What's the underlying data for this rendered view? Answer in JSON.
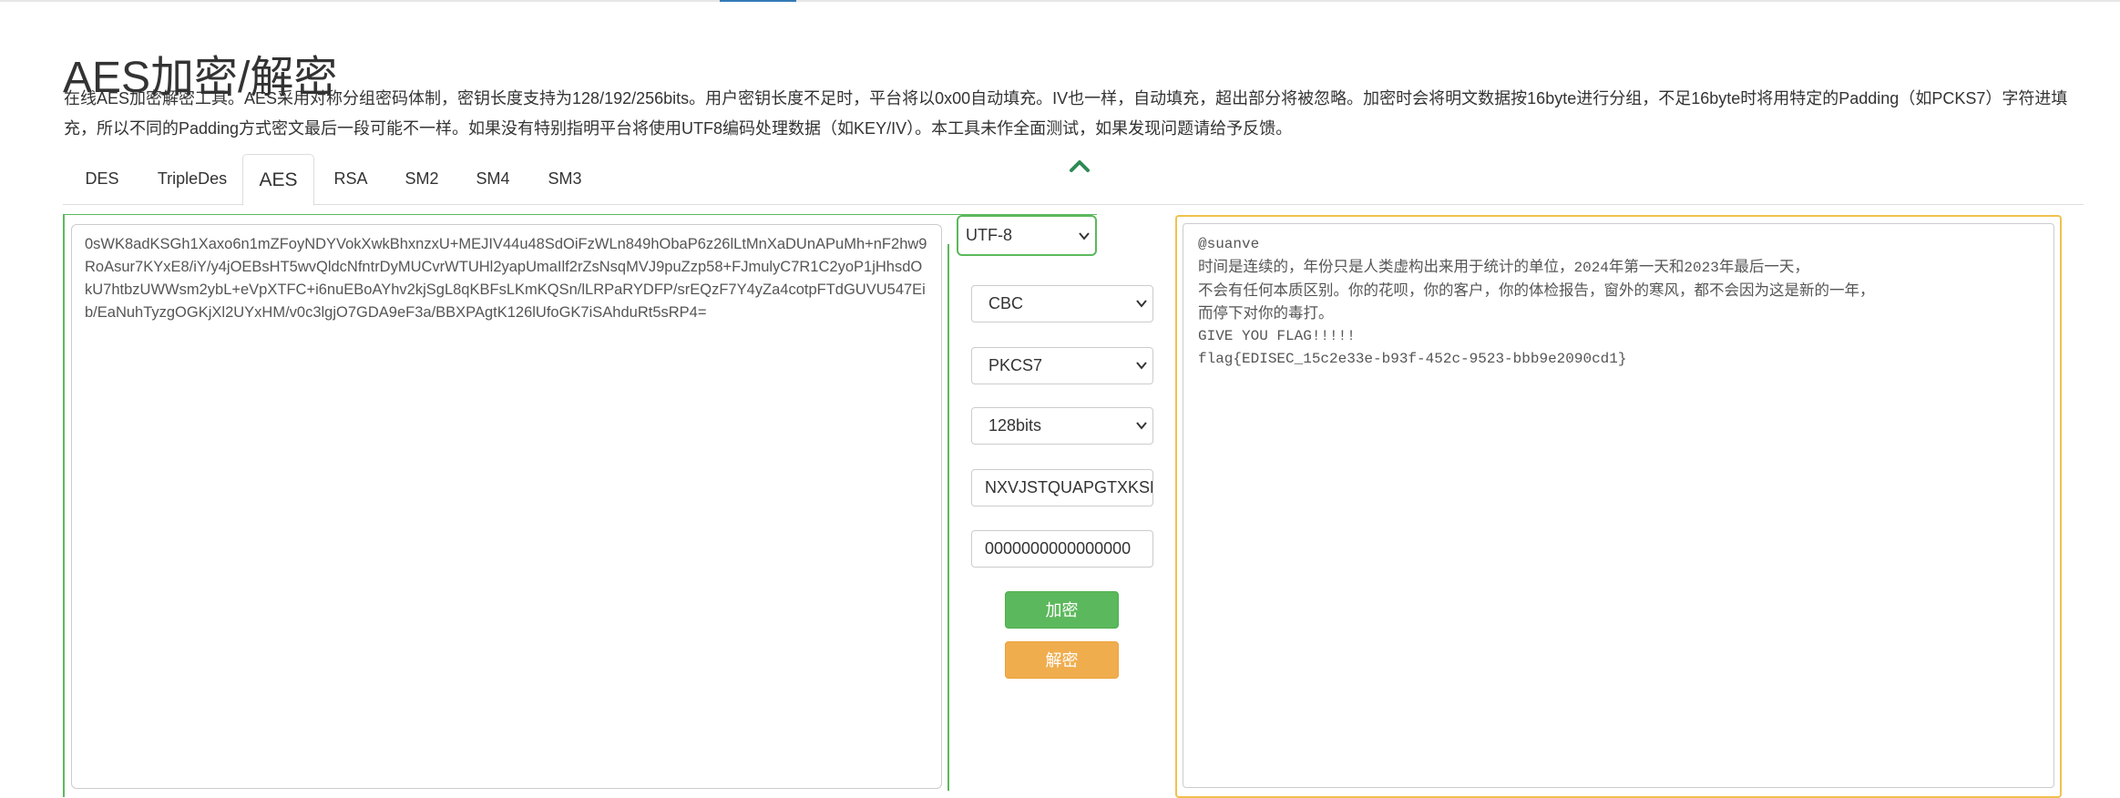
{
  "page": {
    "title": "AES加密/解密",
    "intro": "在线AES加密解密工具。AES采用对称分组密码体制，密钥长度支持为128/192/256bits。用户密钥长度不足时，平台将以0x00自动填充。IV也一样，自动填充，超出部分将被忽略。加密时会将明文数据按16byte进行分组，不足16byte时将用特定的Padding（如PCKS7）字符进填充，所以不同的Padding方式密文最后一段可能不一样。如果没有特别指明平台将使用UTF8编码处理数据（如KEY/IV）。本工具未作全面测试，如果发现问题请给予反馈。"
  },
  "tabs": [
    {
      "label": "DES"
    },
    {
      "label": "TripleDes"
    },
    {
      "label": "AES"
    },
    {
      "label": "RSA"
    },
    {
      "label": "SM2"
    },
    {
      "label": "SM4"
    },
    {
      "label": "SM3"
    }
  ],
  "active_tab": "AES",
  "input": {
    "value": "0sWK8adKSGh1Xaxo6n1mZFoyNDYVokXwkBhxnzxU+MEJIV44u48SdOiFzWLn849hObaP6z26lLtMnXaDUnAPuMh+nF2hw9RoAsur7KYxE8/iY/y4jOEBsHT5wvQldcNfntrDyMUCvrWTUHl2yapUmaIlf2rZsNsqMVJ9puZzp58+FJmulyC7R1C2yoP1jHhsdOkU7htbzUWWsm2ybL+eVpXTFC+i6nuEBoAYhv2kjSgL8qKBFsLKmKQSn/lLRPaRYDFP/srEQzF7Y4yZa4cotpFTdGUVU547Eib/EaNuhTyzgOGKjXl2UYxHM/v0c3lgjO7GDA9eF3a/BBXPAgtK126lUfoGK7iSAhduRt5sRP4="
  },
  "controls": {
    "encoding": "UTF-8",
    "mode": "CBC",
    "padding": "PKCS7",
    "key_size": "128bits",
    "key": "NXVJSTQUAPGTXKSB",
    "iv": "0000000000000000",
    "encrypt_label": "加密",
    "decrypt_label": "解密"
  },
  "output": {
    "line1": "@suanve",
    "line2_a": "时间是连续的，年份只是人类虚构出来用于统计的单位，",
    "line2_b": "2024",
    "line2_c": "年第一天和",
    "line2_d": "2023",
    "line2_e": "年最后一天，",
    "line3": "不会有任何本质区别。你的花呗，你的客户，你的体检报告，窗外的寒风，都不会因为这是新的一年，",
    "line4": "而停下对你的毒打。",
    "line5": "GIVE YOU FLAG!!!!!",
    "line6": "flag{EDISEC_15c2e33e-b93f-452c-9523-bbb9e2090cd1}"
  },
  "colors": {
    "accent_green": "#5cb85c",
    "accent_orange": "#f0ad4e",
    "panel_yellow": "#f0c24d"
  }
}
